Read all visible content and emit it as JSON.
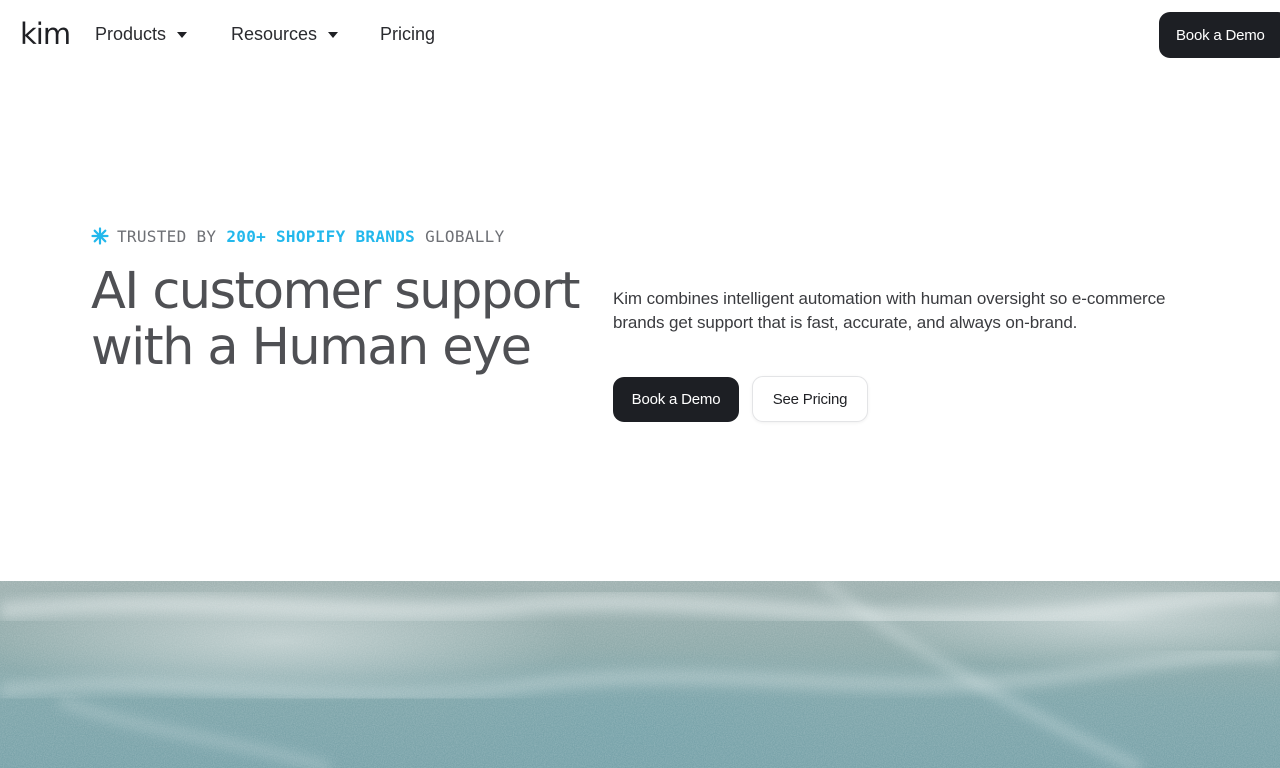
{
  "nav": {
    "logo": "kim",
    "items": [
      {
        "label": "Products",
        "has_dropdown": true
      },
      {
        "label": "Resources",
        "has_dropdown": true
      },
      {
        "label": "Pricing",
        "has_dropdown": false
      }
    ],
    "cta_label": "Book a Demo"
  },
  "hero": {
    "trusted": {
      "icon": "asterisk-icon",
      "prefix": "TRUSTED BY",
      "highlight": "200+ SHOPIFY BRANDS",
      "suffix": "GLOBALLY"
    },
    "headline_line1": "AI customer support",
    "headline_line2": "with a Human eye",
    "description": "Kim combines intelligent automation with human oversight so e-commerce brands get support that is fast, accurate, and always on-brand.",
    "primary_button": "Book a Demo",
    "secondary_button": "See Pricing"
  },
  "colors": {
    "accent": "#23b8ec",
    "dark_button": "#1d1f24",
    "headline": "#4f5054",
    "hero_image": "#8eaaaa"
  }
}
